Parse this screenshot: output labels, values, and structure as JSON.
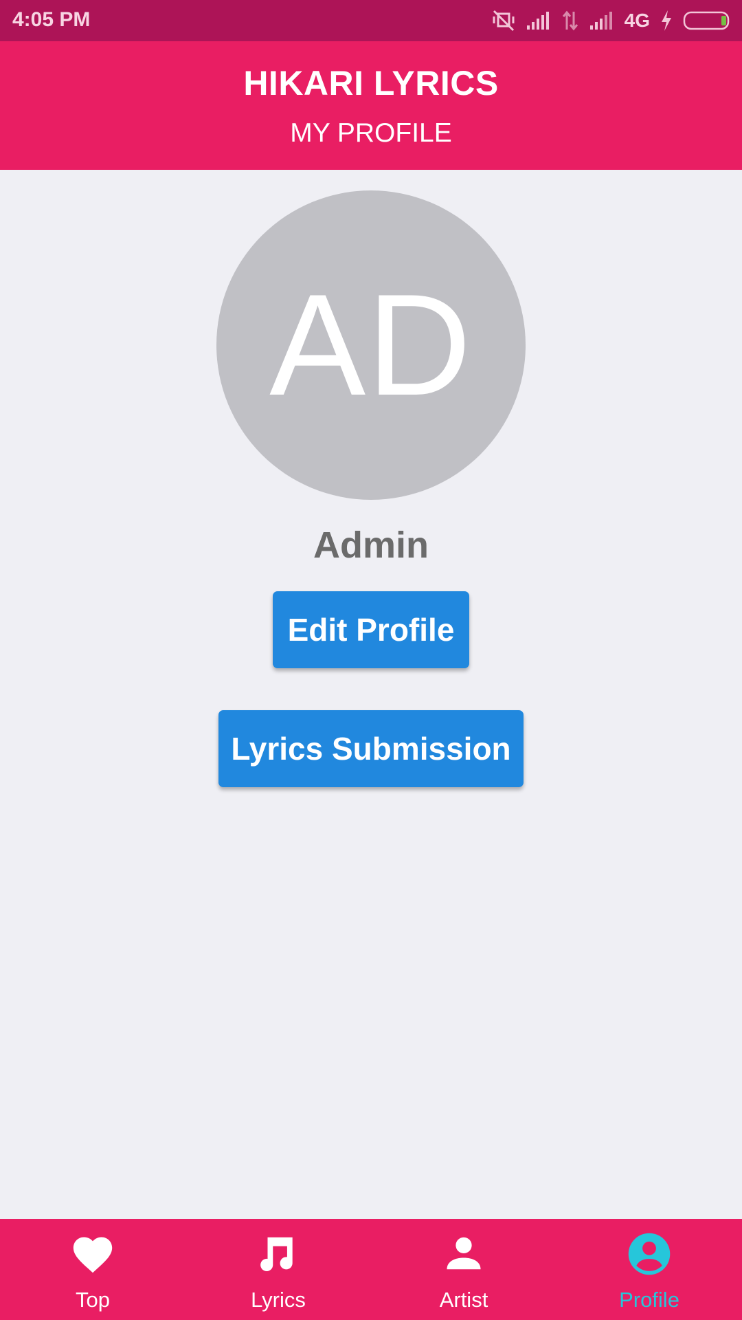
{
  "status_bar": {
    "time": "4:05 PM",
    "network": "4G",
    "icons": [
      "vibrate-off-icon",
      "signal-icon",
      "data-arrows-icon",
      "signal-icon",
      "charging-icon",
      "battery-icon"
    ]
  },
  "header": {
    "title": "HIKARI LYRICS",
    "subtitle": "MY PROFILE"
  },
  "profile": {
    "avatar_initials": "AD",
    "name": "Admin"
  },
  "actions": {
    "edit_label": "Edit Profile",
    "submit_label": "Lyrics Submission"
  },
  "nav": {
    "items": [
      {
        "label": "Top",
        "icon": "heart-icon",
        "active": false
      },
      {
        "label": "Lyrics",
        "icon": "music-note-icon",
        "active": false
      },
      {
        "label": "Artist",
        "icon": "person-icon",
        "active": false
      },
      {
        "label": "Profile",
        "icon": "account-circle-icon",
        "active": true
      }
    ]
  },
  "colors": {
    "status_bar": "#ad1457",
    "primary": "#e91e63",
    "button": "#2188de",
    "active_tab": "#26c6da",
    "avatar_bg": "#c0c0c5",
    "background": "#efeff4"
  }
}
